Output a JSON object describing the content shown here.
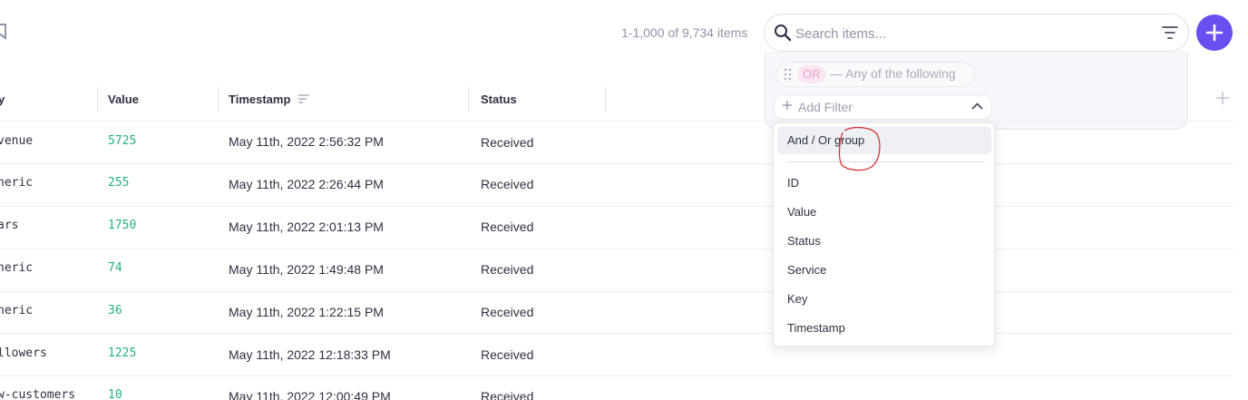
{
  "toolbar": {
    "item_count": "1-1,000 of 9,734 items",
    "search": {
      "placeholder": "Search items...",
      "value": ""
    }
  },
  "filter": {
    "group_operator": "OR",
    "group_description": "— Any of the following",
    "add_filter_label": "Add Filter",
    "menu_items": [
      "And / Or group",
      "ID",
      "Value",
      "Status",
      "Service",
      "Key",
      "Timestamp"
    ]
  },
  "table": {
    "columns": {
      "key": "y",
      "value": "Value",
      "timestamp": "Timestamp",
      "status": "Status"
    },
    "rows": [
      {
        "key": "venue",
        "value": "5725",
        "timestamp": "May 11th, 2022 2:56:32 PM",
        "status": "Received"
      },
      {
        "key": "neric",
        "value": "255",
        "timestamp": "May 11th, 2022 2:26:44 PM",
        "status": "Received"
      },
      {
        "key": "ars",
        "value": "1750",
        "timestamp": "May 11th, 2022 2:01:13 PM",
        "status": "Received"
      },
      {
        "key": "neric",
        "value": "74",
        "timestamp": "May 11th, 2022 1:49:48 PM",
        "status": "Received"
      },
      {
        "key": "neric",
        "value": "36",
        "timestamp": "May 11th, 2022 1:22:15 PM",
        "status": "Received"
      },
      {
        "key": "llowers",
        "value": "1225",
        "timestamp": "May 11th, 2022 12:18:33 PM",
        "status": "Received"
      },
      {
        "key": "w-customers",
        "value": "10",
        "timestamp": "May 11th, 2022 12:00:49 PM",
        "status": "Received"
      }
    ]
  },
  "colors": {
    "accent": "#6b4ef2",
    "value_text": "#22b07d",
    "or_badge_bg": "#fbe6f3",
    "or_badge_text": "#f0a0cf",
    "annotation": "#d42a2a"
  },
  "icons": {
    "top_left": "bookmark-icon",
    "search": "search-icon",
    "filter": "filter-lines-icon",
    "add": "plus-icon",
    "drag": "drag-handle-icon",
    "add_filter": "plus-icon",
    "collapse": "chevron-up-icon",
    "sort": "sort-icon",
    "add_column": "plus-icon"
  }
}
